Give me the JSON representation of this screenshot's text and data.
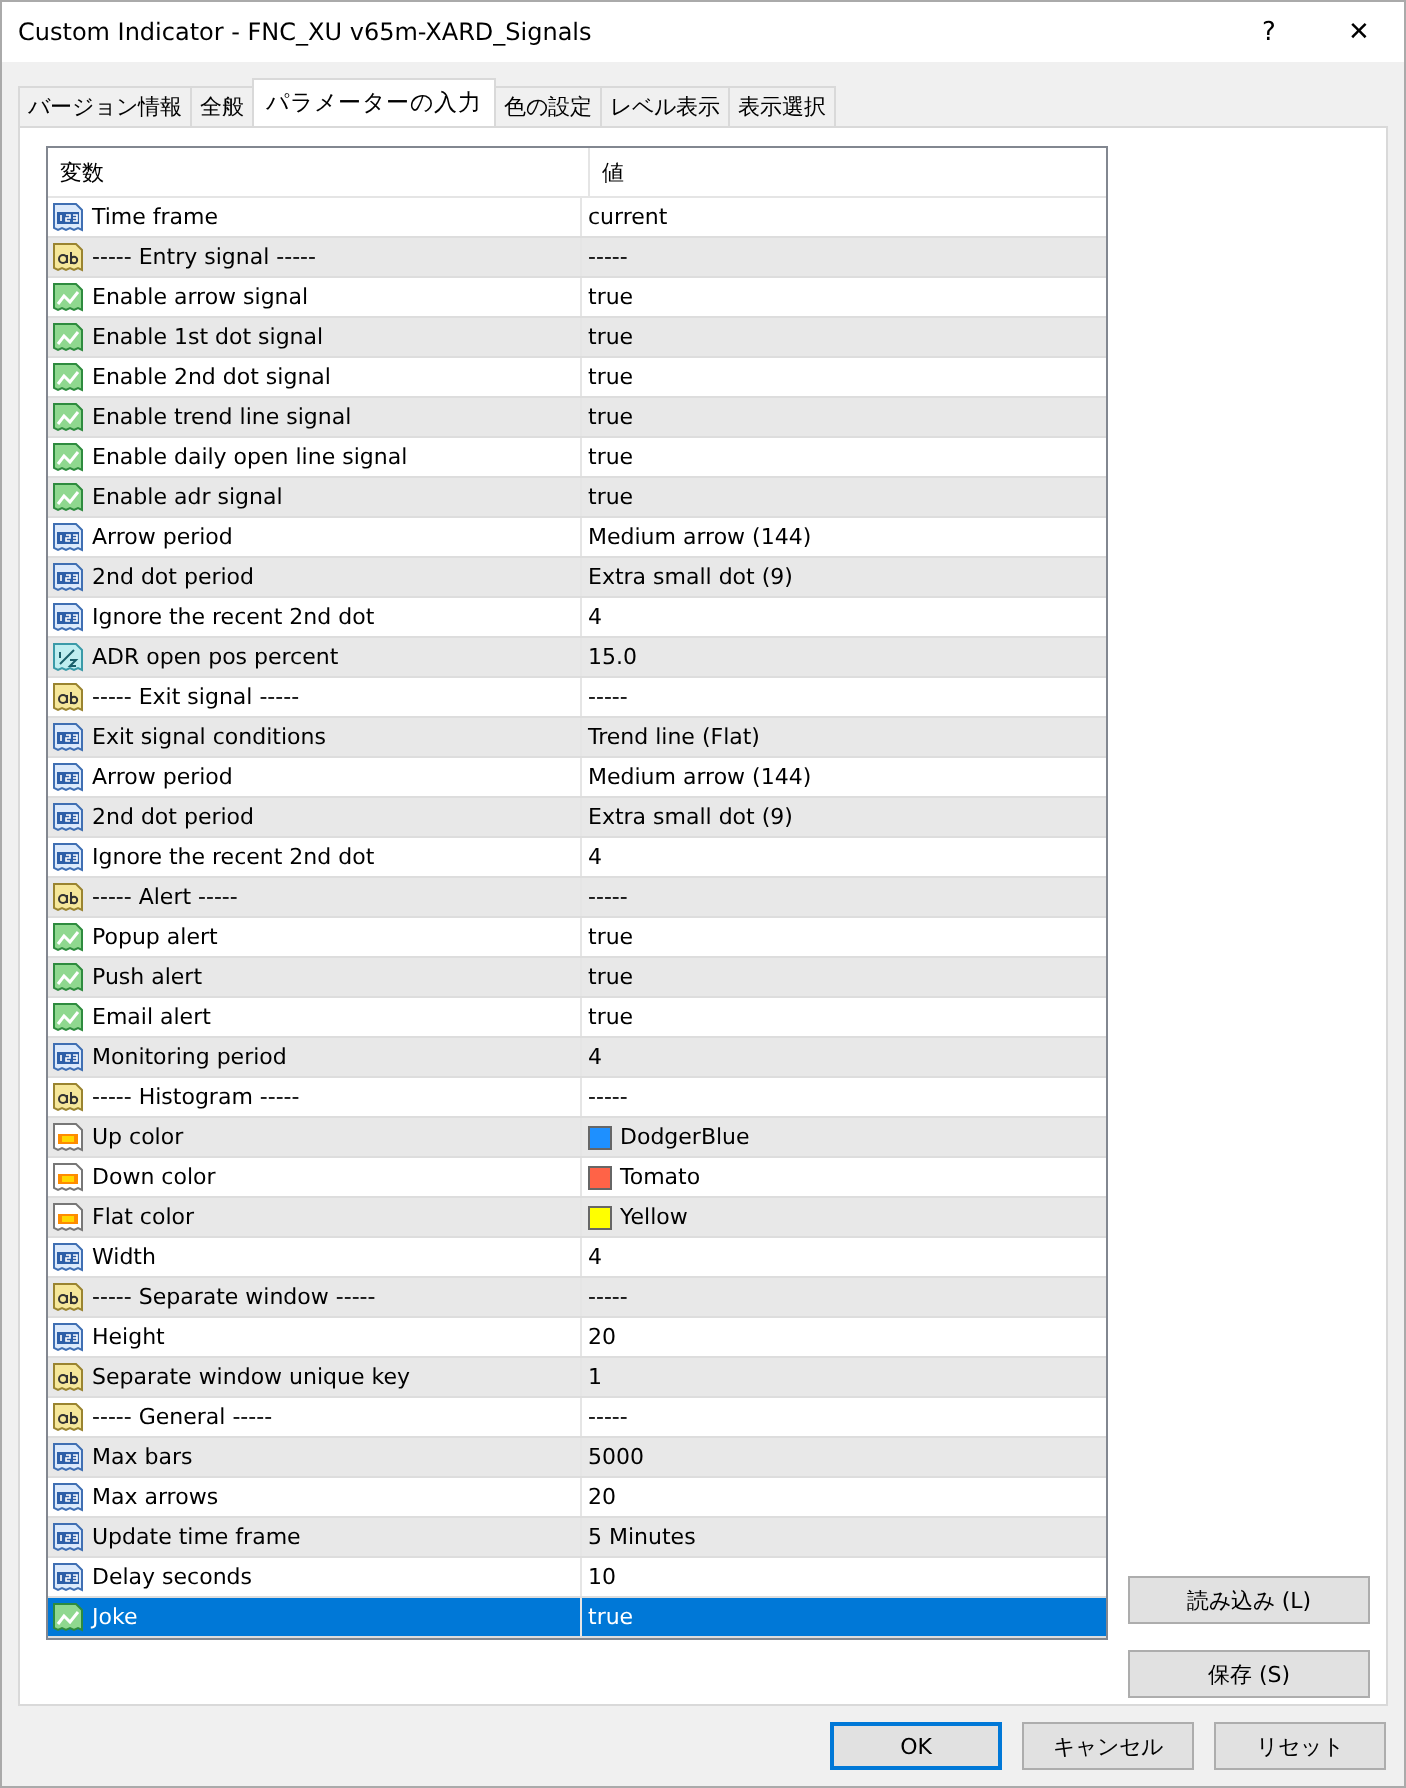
{
  "window": {
    "title": "Custom Indicator - FNC_XU v65m-XARD_Signals",
    "help": "?",
    "close": "✕"
  },
  "tabs": [
    {
      "label": "バージョン情報",
      "selected": false
    },
    {
      "label": "全般",
      "selected": false
    },
    {
      "label": "パラメーターの入力",
      "selected": true
    },
    {
      "label": "色の設定",
      "selected": false
    },
    {
      "label": "レベル表示",
      "selected": false
    },
    {
      "label": "表示選択",
      "selected": false
    }
  ],
  "table": {
    "columns": [
      "変数",
      "値"
    ],
    "rows": [
      {
        "kind": "int",
        "name": "Time frame",
        "value": "current",
        "selected": false
      },
      {
        "kind": "string",
        "name": "----- Entry signal -----",
        "value": "-----",
        "selected": false
      },
      {
        "kind": "bool",
        "name": "Enable arrow signal",
        "value": "true",
        "selected": false
      },
      {
        "kind": "bool",
        "name": "Enable 1st dot signal",
        "value": "true",
        "selected": false
      },
      {
        "kind": "bool",
        "name": "Enable 2nd dot signal",
        "value": "true",
        "selected": false
      },
      {
        "kind": "bool",
        "name": "Enable trend line signal",
        "value": "true",
        "selected": false
      },
      {
        "kind": "bool",
        "name": "Enable daily open line signal",
        "value": "true",
        "selected": false
      },
      {
        "kind": "bool",
        "name": "Enable adr signal",
        "value": "true",
        "selected": false
      },
      {
        "kind": "int",
        "name": "Arrow period",
        "value": "Medium arrow (144)",
        "selected": false
      },
      {
        "kind": "int",
        "name": "2nd dot period",
        "value": "Extra small dot (9)",
        "selected": false
      },
      {
        "kind": "int",
        "name": "Ignore the recent 2nd dot",
        "value": "4",
        "selected": false
      },
      {
        "kind": "double",
        "name": "ADR open pos percent",
        "value": "15.0",
        "selected": false
      },
      {
        "kind": "string",
        "name": "----- Exit signal -----",
        "value": "-----",
        "selected": false
      },
      {
        "kind": "int",
        "name": "Exit signal conditions",
        "value": "Trend line (Flat)",
        "selected": false
      },
      {
        "kind": "int",
        "name": "Arrow period",
        "value": "Medium arrow (144)",
        "selected": false
      },
      {
        "kind": "int",
        "name": "2nd dot period",
        "value": "Extra small dot (9)",
        "selected": false
      },
      {
        "kind": "int",
        "name": "Ignore the recent 2nd dot",
        "value": "4",
        "selected": false
      },
      {
        "kind": "string",
        "name": "----- Alert -----",
        "value": "-----",
        "selected": false
      },
      {
        "kind": "bool",
        "name": "Popup alert",
        "value": "true",
        "selected": false
      },
      {
        "kind": "bool",
        "name": "Push alert",
        "value": "true",
        "selected": false
      },
      {
        "kind": "bool",
        "name": "Email alert",
        "value": "true",
        "selected": false
      },
      {
        "kind": "int",
        "name": "Monitoring period",
        "value": "4",
        "selected": false
      },
      {
        "kind": "string",
        "name": "----- Histogram -----",
        "value": "-----",
        "selected": false
      },
      {
        "kind": "color",
        "name": "Up color",
        "value": "DodgerBlue",
        "color": "#1e90ff",
        "selected": false
      },
      {
        "kind": "color",
        "name": "Down color",
        "value": "Tomato",
        "color": "#ff6347",
        "selected": false
      },
      {
        "kind": "color",
        "name": "Flat color",
        "value": "Yellow",
        "color": "#ffff00",
        "selected": false
      },
      {
        "kind": "int",
        "name": "Width",
        "value": "4",
        "selected": false
      },
      {
        "kind": "string",
        "name": "----- Separate window -----",
        "value": "-----",
        "selected": false
      },
      {
        "kind": "int",
        "name": "Height",
        "value": "20",
        "selected": false
      },
      {
        "kind": "string",
        "name": "Separate window unique key",
        "value": "1",
        "selected": false
      },
      {
        "kind": "string",
        "name": "----- General -----",
        "value": "-----",
        "selected": false
      },
      {
        "kind": "int",
        "name": "Max bars",
        "value": "5000",
        "selected": false
      },
      {
        "kind": "int",
        "name": "Max arrows",
        "value": "20",
        "selected": false
      },
      {
        "kind": "int",
        "name": "Update time frame",
        "value": "5 Minutes",
        "selected": false
      },
      {
        "kind": "int",
        "name": "Delay seconds",
        "value": "10",
        "selected": false
      },
      {
        "kind": "bool",
        "name": "Joke",
        "value": "true",
        "selected": true
      }
    ]
  },
  "side_buttons": [
    "読み込み (L)",
    "保存 (S)"
  ],
  "footer_buttons": [
    {
      "label": "OK",
      "default": true
    },
    {
      "label": "キャンセル",
      "default": false
    },
    {
      "label": "リセット",
      "default": false
    }
  ]
}
